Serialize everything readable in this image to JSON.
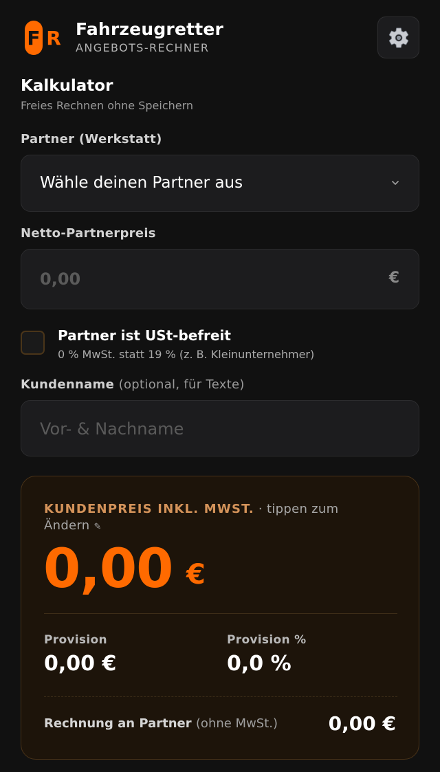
{
  "header": {
    "app_title": "Fahrzeugretter",
    "app_subtitle": "ANGEBOTS-RECHNER",
    "logo_text": "FR",
    "brand_color": "#ff6a00",
    "settings_icon": "gear-icon"
  },
  "calculator": {
    "title": "Kalkulator",
    "subtitle": "Freies Rechnen ohne Speichern"
  },
  "partner": {
    "label": "Partner (Werkstatt)",
    "selected_value": "Wähle deinen Partner aus",
    "icon": "chevron-down-icon"
  },
  "net_price": {
    "label": "Netto-Partnerpreis",
    "placeholder": "0,00",
    "suffix": "€"
  },
  "vat_exempt": {
    "checked": false,
    "label": "Partner ist USt-befreit",
    "description": "0 % MwSt. statt 19 % (z. B. Kleinunternehmer)"
  },
  "customer": {
    "label": "Kundenname",
    "label_optional": "(optional, für Texte)",
    "placeholder": "Vor- & Nachname"
  },
  "result": {
    "heading": "KUNDENPREIS INKL. MWST.",
    "hint": "· tippen zum Ändern",
    "pencil": "✎",
    "price": "0,00",
    "currency": "€",
    "commission_label": "Provision",
    "commission_value": "0,00 €",
    "commission_pct_label": "Provision %",
    "commission_pct_value": "0,0 %",
    "invoice_label": "Rechnung an Partner",
    "invoice_label_optional": "(ohne MwSt.)",
    "invoice_value": "0,00 €"
  }
}
